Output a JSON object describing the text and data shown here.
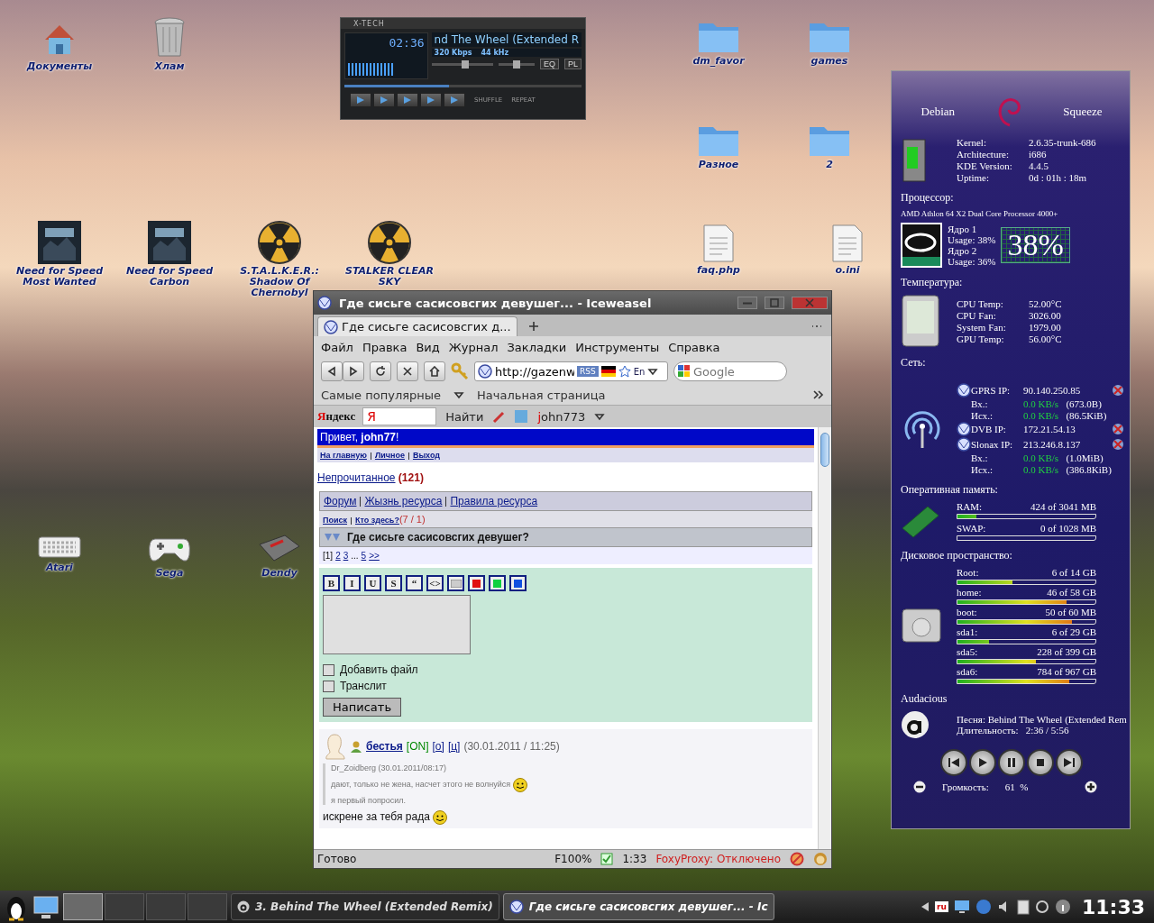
{
  "desktop_icons": [
    {
      "label": "Документы",
      "kind": "home"
    },
    {
      "label": "Хлам",
      "kind": "trash"
    },
    {
      "label": "dm_favor",
      "kind": "folder"
    },
    {
      "label": "games",
      "kind": "folder"
    },
    {
      "label": "Разное",
      "kind": "folder"
    },
    {
      "label": "2",
      "kind": "folder"
    },
    {
      "label": "Need for Speed Most Wanted",
      "kind": "game"
    },
    {
      "label": "Need for Speed Carbon",
      "kind": "game"
    },
    {
      "label": "S.T.A.L.K.E.R.: Shadow Of Chernobyl",
      "kind": "radiation"
    },
    {
      "label": "STALKER CLEAR SKY",
      "kind": "radiation"
    },
    {
      "label": "faq.php",
      "kind": "file"
    },
    {
      "label": "o.ini",
      "kind": "file"
    },
    {
      "label": "Atari",
      "kind": "keyboard"
    },
    {
      "label": "Sega",
      "kind": "gamepad"
    },
    {
      "label": "Dendy",
      "kind": "console"
    }
  ],
  "player": {
    "title": "X-TECH",
    "time": "02:36",
    "song": "nd The Wheel (Extended R",
    "bitrate": "320 Kbps",
    "samplerate": "44 kHz",
    "eq": "EQ",
    "pl": "PL",
    "shuffle": "SHUFFLE",
    "repeat": "REPEAT",
    "volume": {
      "level": 0.55
    },
    "balance": {
      "level": 0.5
    },
    "seek": {
      "level": 0.44
    }
  },
  "browser": {
    "title": "Где сисьге сасисовсгих девушег... - Iceweasel",
    "tab": "Где сисьге сасисовсгих д...",
    "menu": [
      "Файл",
      "Правка",
      "Вид",
      "Журнал",
      "Закладки",
      "Инструменты",
      "Справка"
    ],
    "url": "http://gazenw",
    "rss": "RSS",
    "lang": "En",
    "search_placeholder": "Google",
    "bookmarks": [
      "Самые популярные",
      "Начальная страница"
    ],
    "yandex": {
      "logo": "Яндекс",
      "input": "Я",
      "find": "Найти",
      "user": "john773"
    },
    "page": {
      "greeting": "Привет, **john77**!",
      "nav_links": [
        "На главную",
        "Личное",
        "Выход"
      ],
      "unread": {
        "label": "Непрочитанное",
        "count": "(121)"
      },
      "forum_links": [
        "Форум",
        "Жызнь ресурса",
        "Правила ресурса"
      ],
      "search_links": [
        "Поиск",
        "Кто здесь?"
      ],
      "online": "(7 / 1)",
      "topic": "Где сисьге сасисовсгих девушег?",
      "pages": [
        {
          "label": "[1]",
          "kind": "current"
        },
        {
          "label": "2",
          "kind": "link"
        },
        {
          "label": "3",
          "kind": "link"
        },
        {
          "label": "...",
          "kind": "text"
        },
        {
          "label": "5",
          "kind": "link"
        },
        {
          "label": ">>",
          "kind": "link"
        }
      ],
      "format_buttons": [
        {
          "kind": "text",
          "label": "B"
        },
        {
          "kind": "text",
          "label": "I"
        },
        {
          "kind": "text",
          "label": "U"
        },
        {
          "kind": "text",
          "label": "S"
        },
        {
          "kind": "text",
          "label": "“"
        },
        {
          "kind": "text",
          "label": "<>"
        },
        {
          "kind": "image"
        },
        {
          "kind": "color",
          "color": "#e01010"
        },
        {
          "kind": "color",
          "color": "#10d040"
        },
        {
          "kind": "color",
          "color": "#1050e0"
        }
      ],
      "checkboxes": [
        {
          "label": "Добавить файл",
          "checked": false
        },
        {
          "label": "Транслит",
          "checked": false
        }
      ],
      "submit": "Написать",
      "post": {
        "author": "бестья",
        "status": "[ON]",
        "links": [
          "[о]",
          "[ц]"
        ],
        "date": "(30.01.2011 / 11:25)",
        "quote": {
          "author": "Dr_Zoidberg",
          "date": "(30.01.2011/08:17)",
          "lines": [
            "дают, только не жена, насчет этого не волнуйся",
            "я первый попросил."
          ]
        },
        "text": "искрене за тебя рада"
      }
    },
    "status": {
      "ready": "Готово",
      "zoom": "F100%",
      "time": "1:33",
      "proxy": "FoxyProxy: Отключено"
    }
  },
  "conky": {
    "distro": "Debian",
    "release": "Squeeze",
    "system": [
      {
        "label": "Kernel:",
        "value": "2.6.35-trunk-686"
      },
      {
        "label": "Architecture:",
        "value": "i686"
      },
      {
        "label": "KDE Version:",
        "value": "4.4.5"
      },
      {
        "label": "Uptime:",
        "value": "0d : 01h : 18m"
      }
    ],
    "cpu": {
      "heading": "Процессор:",
      "model": "AMD Athlon 64 X2 Dual Core Processor 4000+",
      "cores": [
        {
          "name": "Ядро 1",
          "usage": "Usage: 38%"
        },
        {
          "name": "Ядро 2",
          "usage": "Usage: 36%"
        }
      ],
      "total": "38%"
    },
    "temperature": {
      "heading": "Температура:",
      "rows": [
        {
          "label": "CPU Temp:",
          "value": "52.00°C"
        },
        {
          "label": "CPU Fan:",
          "value": "3026.00"
        },
        {
          "label": "System Fan:",
          "value": "1979.00"
        },
        {
          "label": "GPU Temp:",
          "value": "56.00°C"
        }
      ]
    },
    "network": {
      "heading": "Сеть:",
      "rows": [
        {
          "kind": "ip",
          "label": "GPRS IP:",
          "value": "90.140.250.85"
        },
        {
          "kind": "traffic",
          "label": "Вх.:",
          "rate": "0.0 KB/s",
          "total": "(673.0B)"
        },
        {
          "kind": "traffic",
          "label": "Исх.:",
          "rate": "0.0 KB/s",
          "total": "(86.5KiB)"
        },
        {
          "kind": "ip",
          "label": "DVB IP:",
          "value": "172.21.54.13"
        },
        {
          "kind": "ip",
          "label": "Slonax IP:",
          "value": "213.246.8.137"
        },
        {
          "kind": "traffic",
          "label": "Вх.:",
          "rate": "0.0 KB/s",
          "total": "(1.0MiB)"
        },
        {
          "kind": "traffic",
          "label": "Исх.:",
          "rate": "0.0 KB/s",
          "total": "(386.8KiB)"
        }
      ]
    },
    "memory": {
      "heading": "Оперативная память:",
      "bars": [
        {
          "label": "RAM:",
          "value": "424 of 3041 MB",
          "level": 0.14
        },
        {
          "label": "SWAP:",
          "value": "0 of 1028 MB",
          "level": 0
        }
      ]
    },
    "disk": {
      "heading": "Дисковое пространство:",
      "bars": [
        {
          "label": "Root:",
          "value": "6 of 14 GB",
          "level": 0.4
        },
        {
          "label": "home:",
          "value": "46 of 58 GB",
          "level": 0.79
        },
        {
          "label": "boot:",
          "value": "50 of 60 MB",
          "level": 0.83
        },
        {
          "label": "sda1:",
          "value": "6 of 29 GB",
          "level": 0.23
        },
        {
          "label": "sda5:",
          "value": "228 of 399 GB",
          "level": 0.57
        },
        {
          "label": "sda6:",
          "value": "784 of 967 GB",
          "level": 0.81
        }
      ]
    },
    "audio": {
      "heading": "Audacious",
      "song": "Песня: Behind The Wheel (Extended Rem",
      "duration_label": "Длительность:",
      "duration": "2:36 / 5:56",
      "volume_label": "Громкость:",
      "volume": "61  %"
    }
  },
  "taskbar": {
    "pager": [
      {
        "selected": true
      },
      {
        "selected": false
      },
      {
        "selected": false
      },
      {
        "selected": false
      }
    ],
    "tasks": [
      {
        "label": "3. Behind The Wheel (Extended Remix)",
        "selected": false
      },
      {
        "label": "Где сисьге сасисовсгих девушег... - Ic",
        "selected": true
      }
    ],
    "layout": "ru",
    "clock": "11:33"
  }
}
